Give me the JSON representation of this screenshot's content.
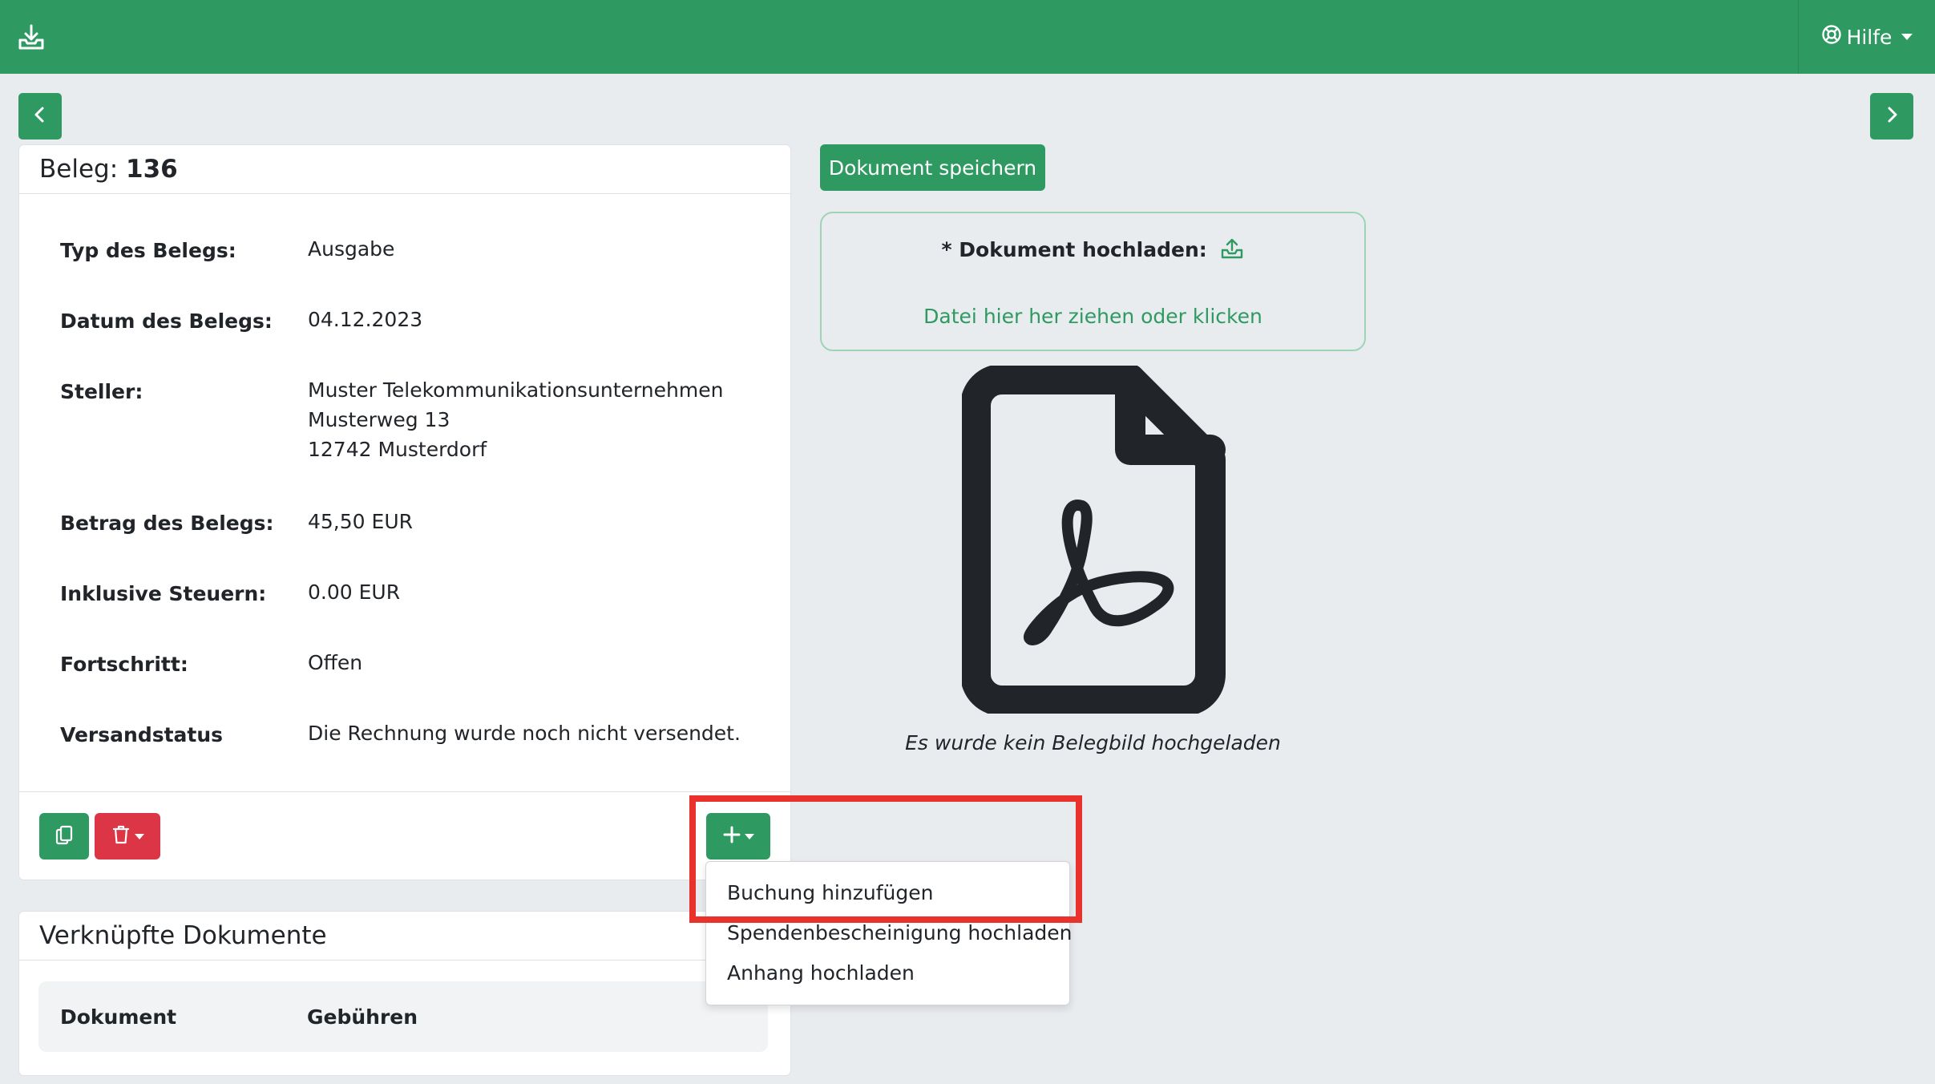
{
  "topbar": {
    "download_icon": "download-tray-icon",
    "help_icon": "lifebuoy-icon",
    "help_label": "Hilfe"
  },
  "nav": {
    "prev_icon": "chevron-left-icon",
    "next_icon": "chevron-right-icon"
  },
  "beleg": {
    "title_prefix": "Beleg: ",
    "number": "136",
    "fields": [
      {
        "label": "Typ des Belegs:",
        "value": "Ausgabe"
      },
      {
        "label": "Datum des Belegs:",
        "value": "04.12.2023"
      },
      {
        "label": "Steller:",
        "value_lines": [
          "Muster Telekommunikationsunternehmen",
          "Musterweg 13",
          "12742 Musterdorf"
        ]
      },
      {
        "label": "Betrag des Belegs:",
        "value": "45,50 EUR"
      },
      {
        "label": "Inklusive Steuern:",
        "value": "0.00 EUR"
      },
      {
        "label": "Fortschritt:",
        "value": "Offen"
      },
      {
        "label": "Versandstatus",
        "value": "Die Rechnung wurde noch nicht versendet."
      }
    ],
    "actions": {
      "copy_icon": "copy-icon",
      "delete_icon": "trash-icon",
      "add_icon": "plus-icon"
    }
  },
  "add_menu": {
    "items": [
      "Buchung hinzufügen",
      "Spendenbescheinigung hochladen",
      "Anhang hochladen"
    ]
  },
  "linked": {
    "title": "Verknüpfte Dokumente",
    "columns": [
      "Dokument",
      "Gebühren"
    ]
  },
  "document": {
    "save_label": "Dokument speichern",
    "upload_title": "* Dokument hochladen:",
    "upload_icon": "upload-cloud-icon",
    "upload_hint": "Datei hier her ziehen oder klicken",
    "placeholder_icon": "file-pdf-icon",
    "no_image_text": "Es wurde kein Belegbild hochgeladen"
  },
  "colors": {
    "primary": "#2e9a62",
    "danger": "#dc3545",
    "highlight": "#e8322b",
    "background": "#e9ecef"
  }
}
